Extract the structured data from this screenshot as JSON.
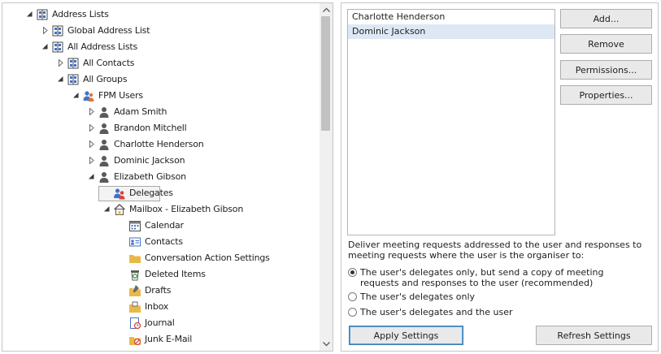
{
  "tree": {
    "items": [
      {
        "label": "Address Lists",
        "indent": 0,
        "expander": "expanded",
        "icon": "address-book-icon"
      },
      {
        "label": "Global Address List",
        "indent": 1,
        "expander": "collapsed",
        "icon": "address-book-icon"
      },
      {
        "label": "All Address Lists",
        "indent": 1,
        "expander": "expanded",
        "icon": "address-book-icon"
      },
      {
        "label": "All Contacts",
        "indent": 2,
        "expander": "collapsed",
        "icon": "address-book-icon"
      },
      {
        "label": "All Groups",
        "indent": 2,
        "expander": "expanded",
        "icon": "address-book-icon"
      },
      {
        "label": "FPM Users",
        "indent": 3,
        "expander": "expanded",
        "icon": "user-group-icon"
      },
      {
        "label": "Adam Smith",
        "indent": 4,
        "expander": "collapsed",
        "icon": "user-icon"
      },
      {
        "label": "Brandon Mitchell",
        "indent": 4,
        "expander": "collapsed",
        "icon": "user-icon"
      },
      {
        "label": "Charlotte Henderson",
        "indent": 4,
        "expander": "collapsed",
        "icon": "user-icon"
      },
      {
        "label": "Dominic Jackson",
        "indent": 4,
        "expander": "collapsed",
        "icon": "user-icon"
      },
      {
        "label": "Elizabeth Gibson",
        "indent": 4,
        "expander": "expanded",
        "icon": "user-icon"
      },
      {
        "label": "Delegates",
        "indent": 5,
        "expander": "none",
        "icon": "delegates-icon",
        "selected": true
      },
      {
        "label": "Mailbox - Elizabeth Gibson",
        "indent": 5,
        "expander": "expanded",
        "icon": "home-icon"
      },
      {
        "label": "Calendar",
        "indent": 6,
        "expander": "none",
        "icon": "calendar-icon"
      },
      {
        "label": "Contacts",
        "indent": 6,
        "expander": "none",
        "icon": "contact-card-icon"
      },
      {
        "label": "Conversation Action Settings",
        "indent": 6,
        "expander": "none",
        "icon": "folder-icon"
      },
      {
        "label": "Deleted Items",
        "indent": 6,
        "expander": "none",
        "icon": "trash-icon"
      },
      {
        "label": "Drafts",
        "indent": 6,
        "expander": "none",
        "icon": "drafts-icon"
      },
      {
        "label": "Inbox",
        "indent": 6,
        "expander": "none",
        "icon": "inbox-icon"
      },
      {
        "label": "Journal",
        "indent": 6,
        "expander": "none",
        "icon": "journal-icon"
      },
      {
        "label": "Junk E-Mail",
        "indent": 6,
        "expander": "none",
        "icon": "junk-mail-icon"
      }
    ]
  },
  "delegates": {
    "items": [
      {
        "label": "Charlotte Henderson",
        "selected": false
      },
      {
        "label": "Dominic Jackson",
        "selected": true
      }
    ]
  },
  "buttons": {
    "add": "Add...",
    "remove": "Remove",
    "permissions": "Permissions...",
    "properties": "Properties...",
    "apply": "Apply Settings",
    "refresh": "Refresh Settings"
  },
  "meeting": {
    "description": "Deliver meeting requests addressed to the user and responses to meeting requests where the user is the organiser to:",
    "options": [
      {
        "label": "The user's delegates only, but send a copy of meeting requests and responses to the user (recommended)",
        "checked": true
      },
      {
        "label": "The user's delegates only",
        "checked": false
      },
      {
        "label": "The user's delegates and the user",
        "checked": false
      }
    ]
  },
  "colors": {
    "selected_row": "#dde8f4",
    "icon_blue": "#4472c4",
    "folder_yellow": "#e8b94a",
    "user_gray": "#5a5a5a"
  }
}
